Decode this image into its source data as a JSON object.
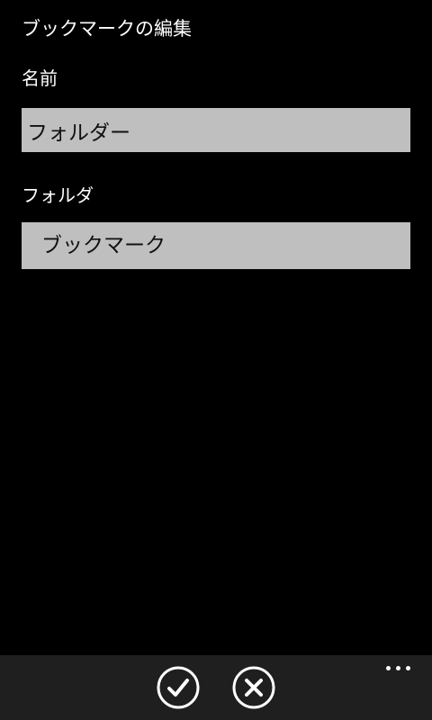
{
  "page": {
    "title": "ブックマークの編集"
  },
  "form": {
    "name_label": "名前",
    "name_value": "フォルダー",
    "folder_label": "フォルダ",
    "folder_value": "ブックマーク"
  },
  "app_bar": {
    "buttons": [
      {
        "icon": "check-icon"
      },
      {
        "icon": "close-icon"
      }
    ],
    "more_icon": "ellipsis-icon"
  },
  "colors": {
    "background": "#000000",
    "input_background": "#bfbfbf",
    "app_bar_background": "#1f1f1f",
    "foreground": "#ffffff"
  }
}
